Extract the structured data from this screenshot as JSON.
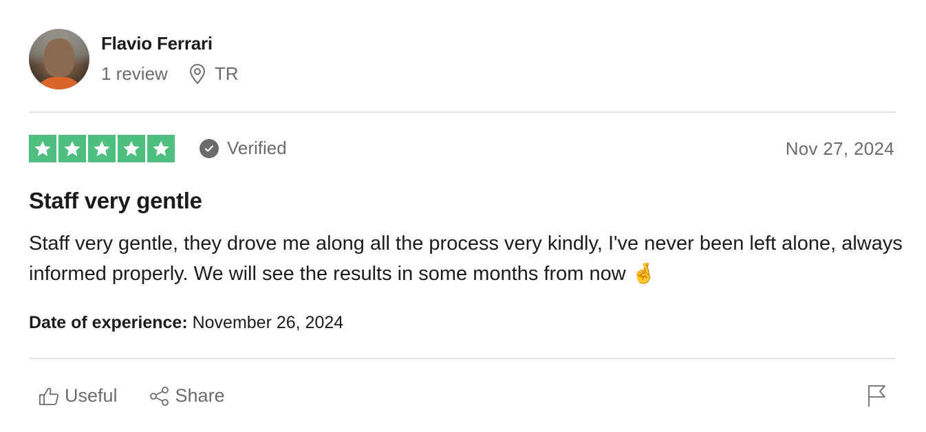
{
  "reviewer": {
    "name": "Flavio Ferrari",
    "review_count": "1 review",
    "country": "TR"
  },
  "rating": {
    "stars": 5,
    "max_stars": 5,
    "verified_label": "Verified",
    "date": "Nov 27, 2024"
  },
  "review": {
    "title": "Staff very gentle",
    "body": "Staff very gentle, they drove me along all the process very kindly, I've never been left alone, always informed properly. We will see the results in some months from now 🤞",
    "experience_label": "Date of experience:",
    "experience_date": "November 26, 2024"
  },
  "actions": {
    "useful_label": "Useful",
    "share_label": "Share"
  },
  "colors": {
    "star_green": "#4fbf7f",
    "muted_text": "#6b6b6b"
  },
  "icons": [
    "location-pin-icon",
    "verified-check-icon",
    "star-icon",
    "thumbs-up-icon",
    "share-icon",
    "flag-icon"
  ]
}
